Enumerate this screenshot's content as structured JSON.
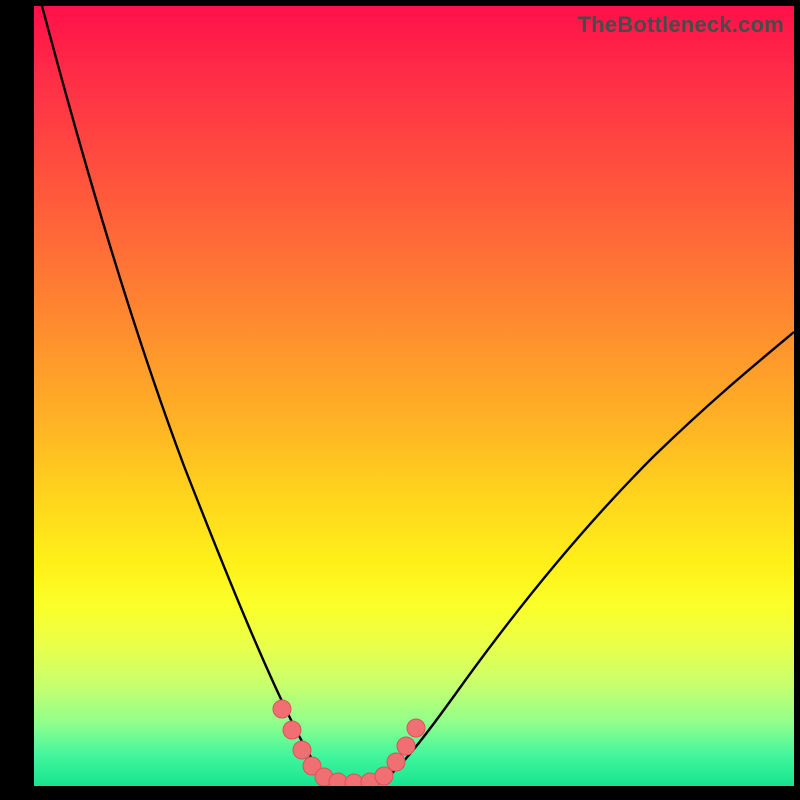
{
  "watermark": "TheBottleneck.com",
  "colors": {
    "frame": "#000000",
    "curve": "#000000",
    "marker_fill": "#ef6f73",
    "marker_stroke": "#d9545a",
    "gradient_stops": [
      "#ff1049",
      "#ff2a48",
      "#ff4740",
      "#ff6a38",
      "#ff8f2e",
      "#ffb524",
      "#ffd81c",
      "#fff21a",
      "#fbff2a",
      "#e9ff4a",
      "#c8ff6e",
      "#8fff8c",
      "#43f69d",
      "#17e48f"
    ]
  },
  "chart_data": {
    "type": "line",
    "title": "",
    "xlabel": "",
    "ylabel": "",
    "xlim": [
      0,
      100
    ],
    "ylim": [
      0,
      100
    ],
    "grid": false,
    "legend": false,
    "series": [
      {
        "name": "left-curve",
        "x": [
          1,
          3,
          5,
          7,
          9,
          11,
          13,
          15,
          17,
          19,
          21,
          23,
          25,
          27,
          29,
          31,
          33,
          34,
          35,
          36,
          37,
          38
        ],
        "y": [
          100,
          94,
          88,
          82,
          76,
          70,
          64,
          58,
          52,
          46,
          40,
          34,
          28,
          23,
          18,
          13,
          9,
          6,
          4,
          2,
          1,
          0
        ]
      },
      {
        "name": "floor",
        "x": [
          38,
          42,
          46
        ],
        "y": [
          0,
          0,
          0
        ]
      },
      {
        "name": "right-curve",
        "x": [
          46,
          48,
          50,
          53,
          56,
          60,
          64,
          68,
          72,
          76,
          80,
          84,
          88,
          92,
          96,
          100
        ],
        "y": [
          0,
          1,
          3,
          6,
          10,
          15,
          20,
          25,
          30,
          35,
          40,
          44,
          48,
          52,
          56,
          60
        ]
      }
    ],
    "markers": {
      "name": "highlight-points",
      "x": [
        32,
        33,
        35,
        37,
        39,
        41,
        43,
        45,
        46,
        48,
        49,
        50
      ],
      "y": [
        10,
        7,
        4,
        2,
        1,
        1,
        1,
        1,
        2,
        4,
        6,
        8
      ],
      "size": 9
    }
  }
}
